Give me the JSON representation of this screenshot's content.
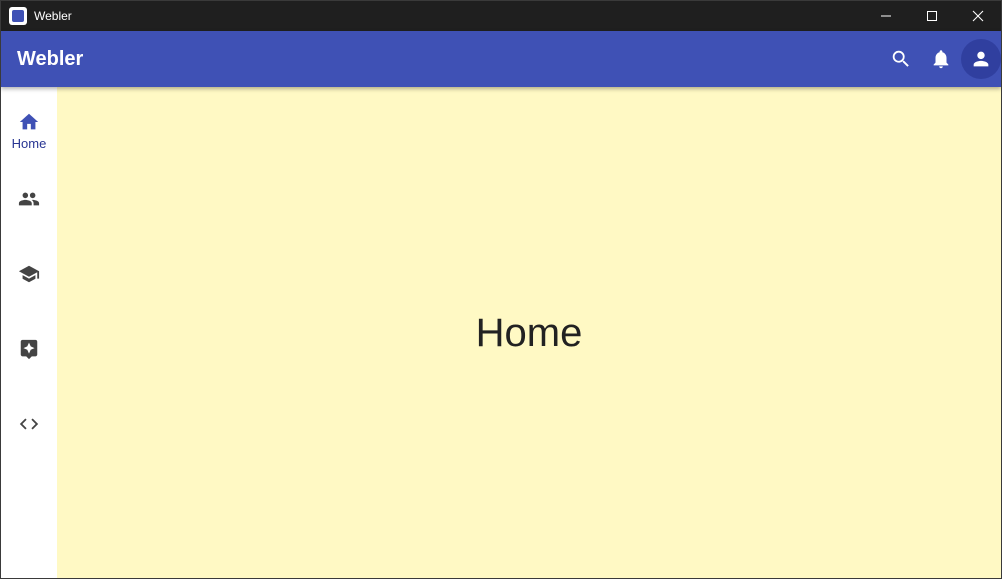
{
  "window": {
    "title": "Webler",
    "controls": [
      "minimize",
      "maximize",
      "close"
    ]
  },
  "appbar": {
    "title": "Webler",
    "background": "#3f51b5",
    "actions": [
      {
        "icon": "search-icon"
      },
      {
        "icon": "bell-icon"
      },
      {
        "icon": "account-icon"
      }
    ]
  },
  "nav": {
    "items": [
      {
        "icon": "home-icon",
        "label": "Home",
        "active": true
      },
      {
        "icon": "people-icon",
        "label": "",
        "active": false
      },
      {
        "icon": "school-icon",
        "label": "",
        "active": false
      },
      {
        "icon": "sparkle-icon",
        "label": "",
        "active": false
      },
      {
        "icon": "code-icon",
        "label": "",
        "active": false
      }
    ]
  },
  "main": {
    "heading": "Home",
    "background": "#fff9c4"
  }
}
